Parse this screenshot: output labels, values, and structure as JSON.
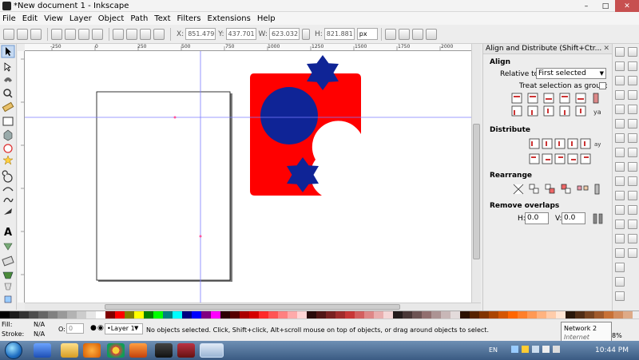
{
  "window": {
    "title": "*New document 1 - Inkscape",
    "minimize": "–",
    "maximize": "□",
    "close": "✕"
  },
  "menu": [
    "File",
    "Edit",
    "View",
    "Layer",
    "Object",
    "Path",
    "Text",
    "Filters",
    "Extensions",
    "Help"
  ],
  "toolbar": {
    "x_label": "X:",
    "x_value": "851.479",
    "y_label": "Y:",
    "y_value": "437.701",
    "w_label": "W:",
    "w_value": "623.032",
    "h_label": "H:",
    "h_value": "821.881",
    "unit": "px"
  },
  "ruler_top_labels": [
    "-250",
    "0",
    "250",
    "500",
    "750",
    "1000",
    "1250",
    "1500",
    "1750",
    "2000"
  ],
  "dock": {
    "title": "Align and Distribute (Shift+Ctr...",
    "close_glyph": "✕",
    "align_heading": "Align",
    "relative_to_label": "Relative to:",
    "relative_to_value": "First selected",
    "treat_as_group_label": "Treat selection as group:",
    "distribute_heading": "Distribute",
    "rearrange_heading": "Rearrange",
    "remove_overlaps_heading": "Remove overlaps",
    "h_label": "H:",
    "h_value": "0.0",
    "v_label": "V:",
    "v_value": "0.0"
  },
  "statusbar": {
    "fill_label": "Fill:",
    "fill_value": "N/A",
    "stroke_label": "Stroke:",
    "stroke_value": "N/A",
    "opacity_label": "O:",
    "opacity_value": "0",
    "layer_name": "•Layer 1",
    "message": "No objects selected. Click, Shift+click, Alt+scroll mouse on top of objects, or drag around objects to select.",
    "zoom_suffix": "8%"
  },
  "tooltip": {
    "line1": "Network  2",
    "line2": "Internet access"
  },
  "taskbar": {
    "language": "EN",
    "clock": "10:44 PM"
  },
  "colors": {
    "red_shape": "#ff0000",
    "navy_shape": "#0f2496",
    "guide": "#7b7bff"
  }
}
